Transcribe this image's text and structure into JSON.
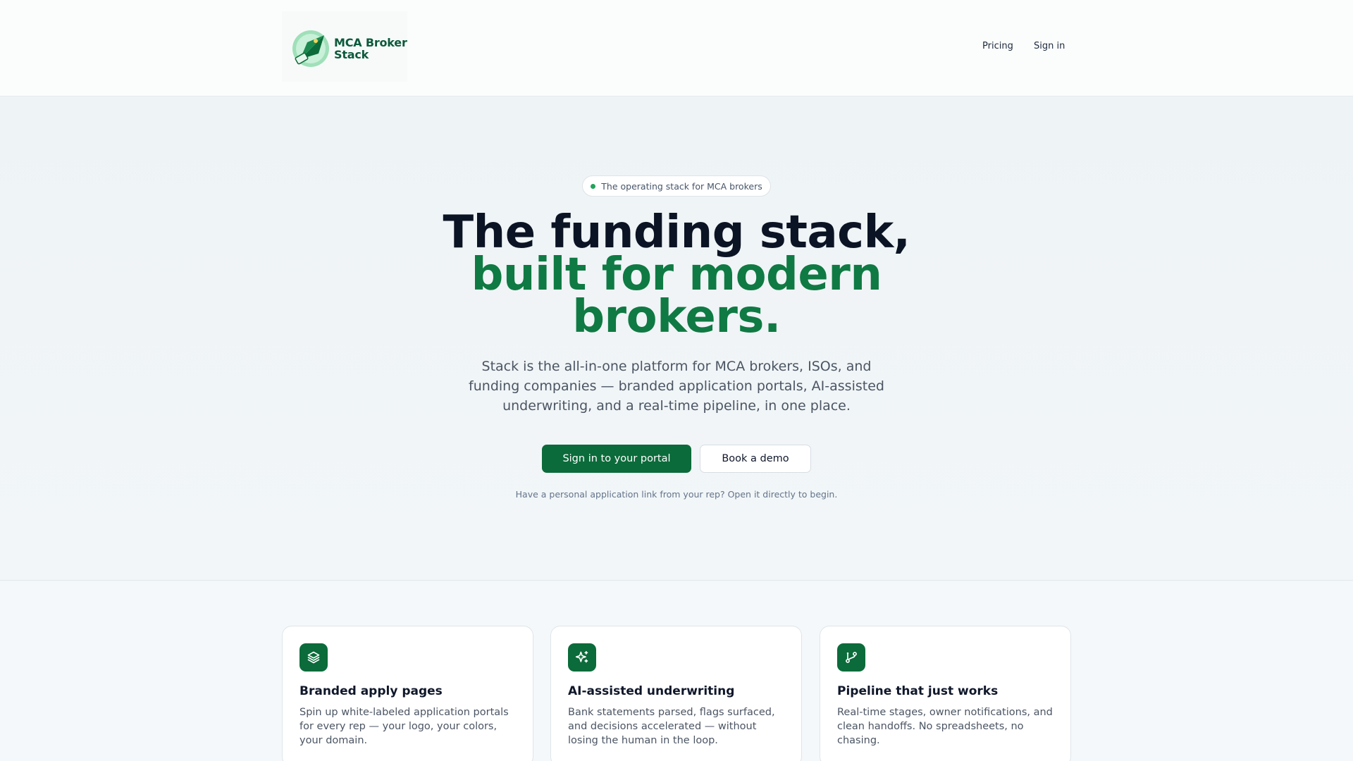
{
  "brand": {
    "name_line1": "MCA Broker",
    "name_line2": "Stack",
    "color": "#0b5a3c"
  },
  "nav": {
    "pricing": "Pricing",
    "sign_in": "Sign in"
  },
  "hero": {
    "badge": "The operating stack for MCA brokers",
    "headline_line1": "The funding stack,",
    "headline_line2": "built for modern",
    "headline_line3": "brokers.",
    "subtitle": "Stack is the all-in-one platform for MCA brokers, ISOs, and funding companies — branded application portals, AI-assisted underwriting, and a real-time pipeline, in one place.",
    "primary_cta": "Sign in to your portal",
    "secondary_cta": "Book a demo",
    "hint": "Have a personal application link from your rep? Open it directly to begin."
  },
  "features": [
    {
      "icon": "layers-icon",
      "title": "Branded apply pages",
      "description": "Spin up white-labeled application portals for every rep — your logo, your colors, your domain."
    },
    {
      "icon": "sparkles-icon",
      "title": "AI-assisted underwriting",
      "description": "Bank statements parsed, flags surfaced, and decisions accelerated — without losing the human in the loop."
    },
    {
      "icon": "git-branch-icon",
      "title": "Pipeline that just works",
      "description": "Real-time stages, owner notifications, and clean handoffs. No spreadsheets, no chasing."
    }
  ],
  "colors": {
    "accent": "#0b6b3a",
    "headline_green": "#0f7a43",
    "badge_dot": "#22a35a"
  }
}
